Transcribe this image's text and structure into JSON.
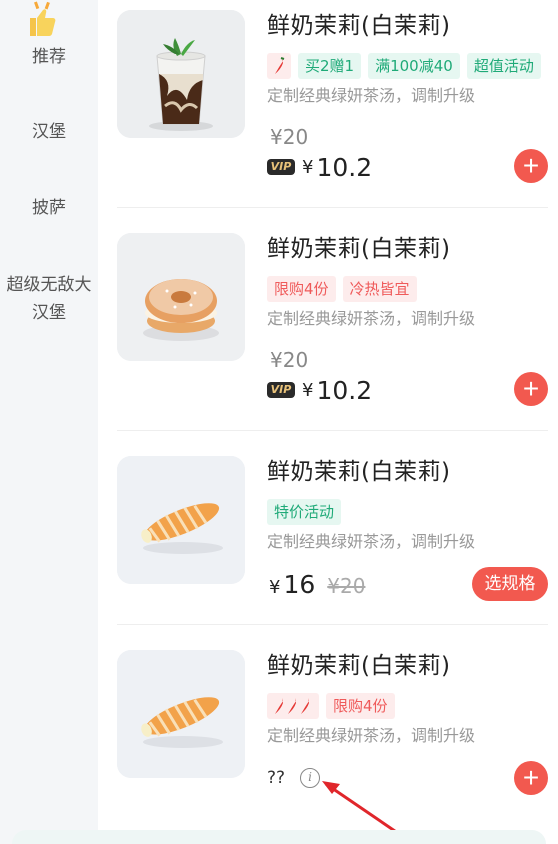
{
  "sidebar": {
    "items": [
      {
        "label": "推荐",
        "active": true
      },
      {
        "label": "汉堡"
      },
      {
        "label": "披萨"
      },
      {
        "label": "超级无敌大汉堡",
        "line1": "超级无敌大",
        "line2": "汉堡"
      }
    ]
  },
  "products": [
    {
      "name": "鲜奶茉莉(白茉莉)",
      "tags": [
        "买2赠1",
        "满100减40",
        "超值活动"
      ],
      "desc": "定制经典绿妍茶汤，调制升级",
      "orig_price": "¥20",
      "vip_badge": "VIP",
      "yen": "¥",
      "vip_price": "10.2",
      "add_icon": "+"
    },
    {
      "name": "鲜奶茉莉(白茉莉)",
      "tags": [
        "限购4份",
        "冷热皆宜"
      ],
      "desc": "定制经典绿妍茶汤，调制升级",
      "orig_price": "¥20",
      "vip_badge": "VIP",
      "yen": "¥",
      "vip_price": "10.2",
      "add_icon": "+"
    },
    {
      "name": "鲜奶茉莉(白茉莉)",
      "tags": [
        "特价活动"
      ],
      "desc": "定制经典绿妍茶汤，调制升级",
      "yen": "¥",
      "sale_price": "16",
      "old_price": "¥20",
      "spec_button": "选规格"
    },
    {
      "name": "鲜奶茉莉(白茉莉)",
      "tags": [
        "限购4份"
      ],
      "desc": "定制经典绿妍茶汤，调制升级",
      "price_text": "??",
      "info_icon": "i",
      "add_icon": "+"
    }
  ],
  "colors": {
    "accent": "#f2594f",
    "green_tag": "#1faa78",
    "red_tag": "#ef5a5a"
  },
  "icons": [
    "thumbs-up-icon",
    "chili-pepper-icon",
    "info-icon",
    "plus-icon"
  ]
}
